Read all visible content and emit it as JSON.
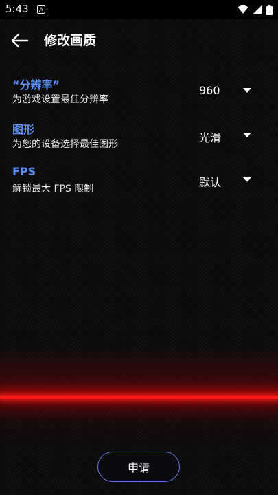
{
  "status_bar": {
    "time": "5:43",
    "app_icon_letter": "A",
    "icons": [
      "wifi-icon",
      "signal-icon",
      "battery-icon"
    ]
  },
  "header": {
    "title": "修改画质",
    "back_icon": "arrow-left-icon"
  },
  "settings": [
    {
      "title": "“分辨率”",
      "description": "为游戏设置最佳分辨率",
      "value": "960",
      "icon": "dropdown-triangle-icon"
    },
    {
      "title": "图形",
      "description": "为您的设备选择最佳图形",
      "value": "光滑",
      "icon": "dropdown-triangle-icon"
    },
    {
      "title": "FPS",
      "description": "解锁最大 FPS 限制",
      "value": "默认",
      "icon": "dropdown-triangle-icon"
    }
  ],
  "footer": {
    "apply_label": "申请"
  },
  "colors": {
    "accent_blue": "#5b8def",
    "button_border": "#6b7ae0",
    "glow_red": "#ff1a1a",
    "background": "#0c0c0e"
  }
}
